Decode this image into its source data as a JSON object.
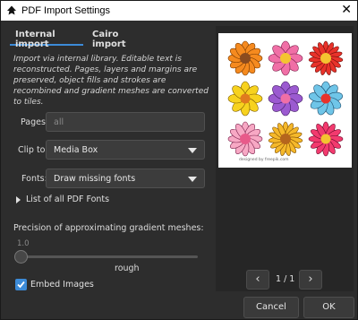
{
  "window": {
    "title": "PDF Import Settings",
    "close_glyph": "✕"
  },
  "tabs": [
    {
      "label": "Internal import",
      "active": true
    },
    {
      "label": "Cairo import",
      "active": false
    }
  ],
  "description": "Import via internal library. Editable text is reconstructed. Pages, layers and margins are preserved, object fills and strokes are recombined and gradient meshes are converted to tiles.",
  "pages": {
    "label": "Pages:",
    "value": "all"
  },
  "clip_to": {
    "label": "Clip to:",
    "value": "Media Box"
  },
  "fonts": {
    "label": "Fonts:",
    "value": "Draw missing fonts"
  },
  "fonts_list": {
    "label": "List of all PDF Fonts"
  },
  "precision": {
    "label": "Precision of approximating gradient meshes:",
    "value": "1.0",
    "quality_label": "rough"
  },
  "embed_images": {
    "label": "Embed Images",
    "checked": true
  },
  "preview": {
    "credit": "designed by freepik.com",
    "page": "1 / 1"
  },
  "buttons": {
    "cancel": "Cancel",
    "ok": "OK"
  },
  "accent_color": "#3c8bd8"
}
